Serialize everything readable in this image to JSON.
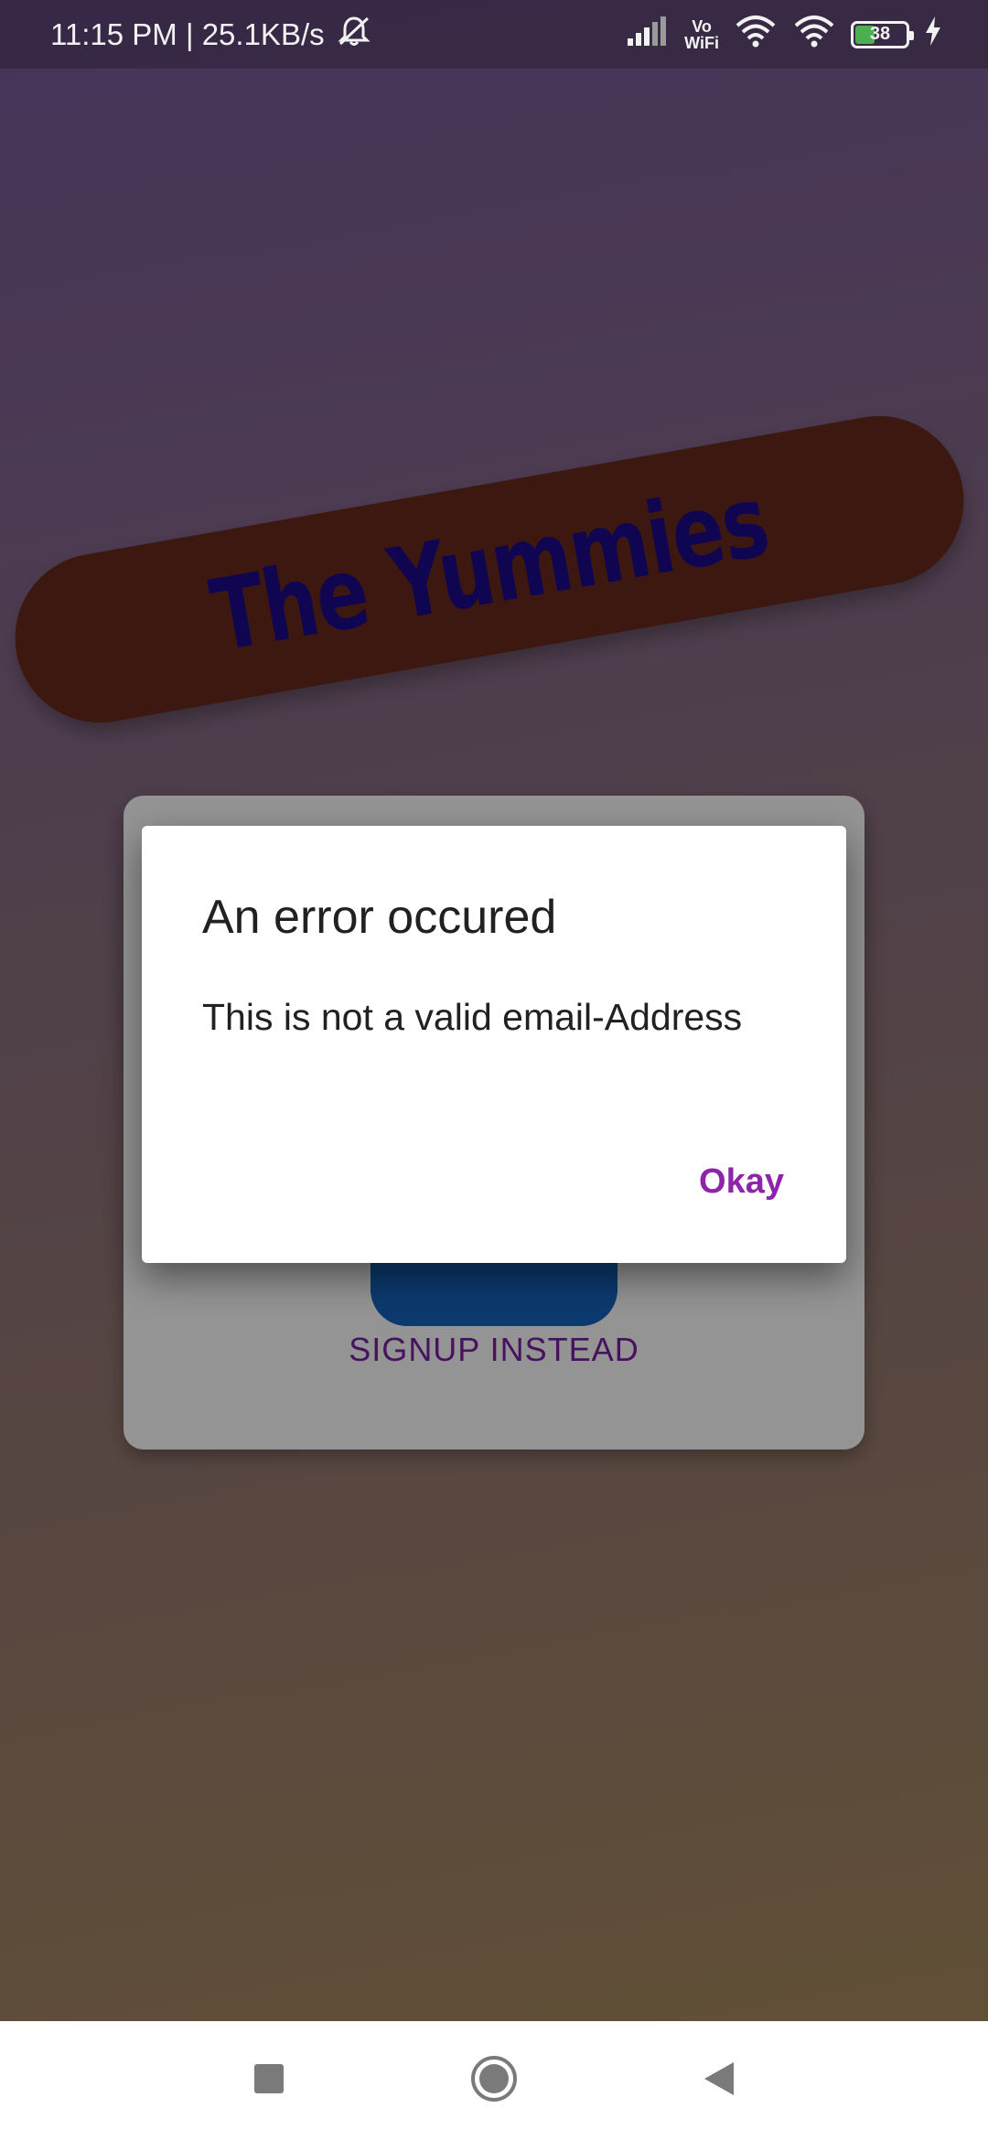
{
  "status_bar": {
    "time_speed": "11:15 PM | 25.1KB/s",
    "vowifi_top": "Vo",
    "vowifi_bottom": "WiFi",
    "battery": "38",
    "icons": [
      "mute-icon",
      "signal-icon",
      "wifi-icon",
      "hotspot-icon",
      "battery-icon",
      "charging-icon"
    ]
  },
  "logo": {
    "text": "The Yummies",
    "banner_color": "#6a2a1c",
    "text_color": "#1c0a8a"
  },
  "auth_card": {
    "signup_label": "SIGNUP INSTEAD",
    "login_button_color": "#1565c0"
  },
  "dialog": {
    "title": "An error occured",
    "message": "This is not a valid email-Address",
    "action_label": "Okay",
    "action_color": "#8e24aa"
  },
  "nav_bar": {
    "icons": [
      "recents-icon",
      "home-icon",
      "back-icon"
    ]
  }
}
